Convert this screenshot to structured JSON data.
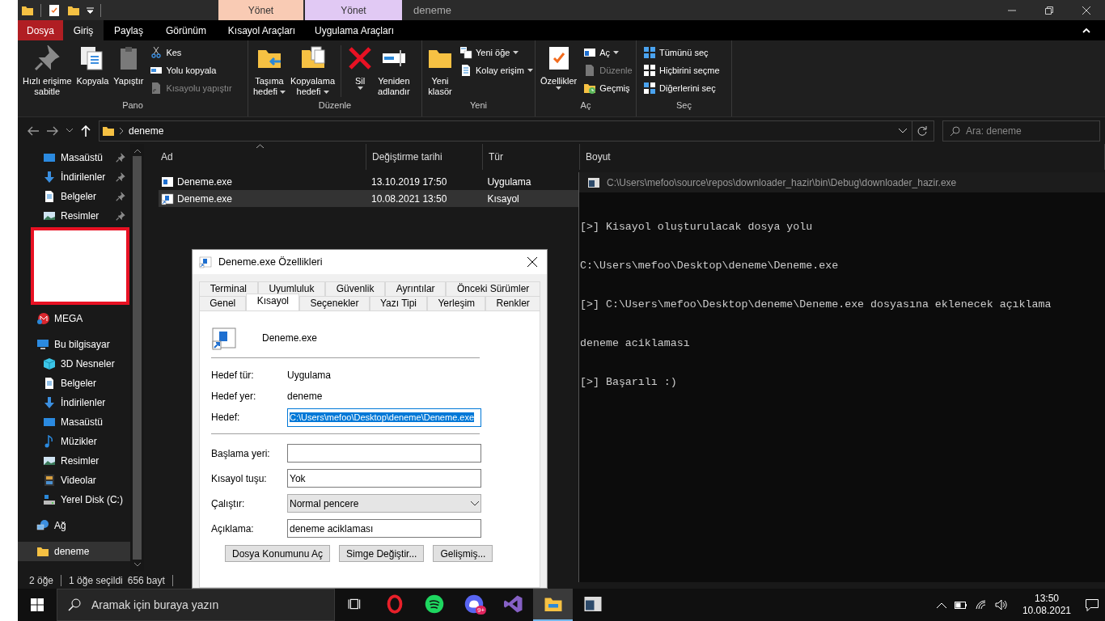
{
  "explorer": {
    "title": "deneme",
    "context_headers": [
      {
        "label": "Yönet",
        "color": "#f9cbb4"
      },
      {
        "label": "Yönet",
        "color": "#e1c9f4"
      }
    ],
    "ribbon_tabs": [
      {
        "label": "Dosya",
        "kind": "file",
        "selected": false
      },
      {
        "label": "Giriş",
        "kind": "tab",
        "selected": true
      },
      {
        "label": "Paylaş",
        "kind": "tab",
        "selected": false
      },
      {
        "label": "Görünüm",
        "kind": "tab",
        "selected": false
      },
      {
        "label": "Kısayol Araçları",
        "kind": "context",
        "selected": false
      },
      {
        "label": "Uygulama Araçları",
        "kind": "context",
        "selected": false
      }
    ],
    "ribbon_groups": [
      {
        "label": "Pano",
        "large": [
          {
            "lines": [
              "Hızlı erişime",
              "sabitle"
            ],
            "kind": "pin",
            "caret": false
          },
          {
            "lines": [
              "Kopyala"
            ],
            "kind": "copy",
            "caret": false
          },
          {
            "lines": [
              "Yapıştır"
            ],
            "kind": "paste",
            "caret": false
          }
        ],
        "small": [
          {
            "label": "Kes",
            "kind": "cut",
            "caret": false,
            "disabled": false
          },
          {
            "label": "Yolu kopyala",
            "kind": "path",
            "caret": false,
            "disabled": false
          },
          {
            "label": "Kısayolu yapıştır",
            "kind": "shortcut",
            "caret": false,
            "disabled": true
          }
        ]
      },
      {
        "label": "Düzenle",
        "large": [
          {
            "lines": [
              "Taşıma",
              "hedefi"
            ],
            "kind": "move",
            "caret": true
          },
          {
            "lines": [
              "Kopyalama",
              "hedefi"
            ],
            "kind": "copyto",
            "caret": true
          },
          {
            "lines": [
              "Sil"
            ],
            "kind": "delete",
            "caret": true,
            "divider_before": true
          },
          {
            "lines": [
              "Yeniden",
              "adlandır"
            ],
            "kind": "rename",
            "caret": false
          }
        ]
      },
      {
        "label": "Yeni",
        "large": [
          {
            "lines": [
              "Yeni",
              "klasör"
            ],
            "kind": "folder",
            "caret": false
          }
        ],
        "small": [
          {
            "label": "Yeni öğe",
            "kind": "newitem",
            "caret": true,
            "disabled": false
          },
          {
            "label": "Kolay erişim",
            "kind": "easy",
            "caret": true,
            "disabled": false
          }
        ]
      },
      {
        "label": "Aç",
        "large": [
          {
            "lines": [
              "Özellikler"
            ],
            "kind": "properties",
            "caret": true
          }
        ],
        "small": [
          {
            "label": "Aç",
            "kind": "open",
            "caret": true,
            "disabled": false
          },
          {
            "label": "Düzenle",
            "kind": "edit",
            "caret": false,
            "disabled": true
          },
          {
            "label": "Geçmiş",
            "kind": "history",
            "caret": false,
            "disabled": false
          }
        ]
      },
      {
        "label": "Seç",
        "small": [
          {
            "label": "Tümünü seç",
            "kind": "all",
            "caret": false,
            "disabled": false
          },
          {
            "label": "Hiçbirini seçme",
            "kind": "none",
            "caret": false,
            "disabled": false
          },
          {
            "label": "Diğerlerini seç",
            "kind": "invert",
            "caret": false,
            "disabled": false
          }
        ]
      }
    ],
    "address": {
      "crumb": "deneme",
      "search_placeholder": "Ara: deneme"
    },
    "sidebar": {
      "quick_access": [
        {
          "label": "Masaüstü",
          "kind": "desktop",
          "pinned": true,
          "selected": false
        },
        {
          "label": "İndirilenler",
          "kind": "download",
          "pinned": true,
          "selected": false
        },
        {
          "label": "Belgeler",
          "kind": "docs",
          "pinned": true,
          "selected": false
        },
        {
          "label": "Resimler",
          "kind": "pictures",
          "pinned": true,
          "selected": false
        }
      ],
      "redacted": true,
      "locations": [
        {
          "label": "MEGA",
          "kind": "mega",
          "selected": false
        },
        {
          "label": "Bu bilgisayar",
          "kind": "pc",
          "selected": false,
          "children": [
            {
              "label": "3D Nesneler",
              "kind": "cube",
              "selected": false
            },
            {
              "label": "Belgeler",
              "kind": "docs",
              "selected": false
            },
            {
              "label": "İndirilenler",
              "kind": "download",
              "selected": false
            },
            {
              "label": "Masaüstü",
              "kind": "desktop",
              "selected": false
            },
            {
              "label": "Müzikler",
              "kind": "music",
              "selected": false
            },
            {
              "label": "Resimler",
              "kind": "pictures",
              "selected": false
            },
            {
              "label": "Videolar",
              "kind": "video",
              "selected": false
            },
            {
              "label": "Yerel Disk (C:)",
              "kind": "disk",
              "selected": false
            }
          ]
        },
        {
          "label": "Ağ",
          "kind": "network",
          "selected": false
        },
        {
          "label": "deneme",
          "kind": "folder",
          "selected": true
        }
      ]
    },
    "table": {
      "columns": [
        {
          "label": "Ad",
          "sorted": true
        },
        {
          "label": "Değiştirme tarihi",
          "sorted": false
        },
        {
          "label": "Tür",
          "sorted": false
        },
        {
          "label": "Boyut",
          "sorted": false
        }
      ],
      "rows": [
        {
          "name": "Deneme.exe",
          "date": "13.10.2019 17:50",
          "type": "Uygulama",
          "kind": "app",
          "selected": false
        },
        {
          "name": "Deneme.exe",
          "date": "10.08.2021 13:50",
          "type": "Kısayol",
          "kind": "shortcut",
          "selected": true
        }
      ]
    },
    "status_bar": {
      "item_count": "2 öğe",
      "selection": "1 öğe seçildi",
      "size": "656 bayt"
    }
  },
  "console": {
    "title": "C:\\Users\\mefoo\\source\\repos\\downloader_hazir\\bin\\Debug\\downloader_hazir.exe",
    "lines": [
      "[>] Kisayol oluşturulacak dosya yolu",
      "C:\\Users\\mefoo\\Desktop\\deneme\\Deneme.exe",
      "[>] C:\\Users\\mefoo\\Desktop\\deneme\\Deneme.exe dosyasına eklenecek açıklama",
      "deneme aciklaması",
      "[>] Başarılı :)"
    ]
  },
  "dialog": {
    "title": "Deneme.exe Özellikleri",
    "tab_rows": [
      [
        {
          "label": "Terminal",
          "selected": false
        },
        {
          "label": "Uyumluluk",
          "selected": false
        },
        {
          "label": "Güvenlik",
          "selected": false
        },
        {
          "label": "Ayrıntılar",
          "selected": false
        },
        {
          "label": "Önceki Sürümler",
          "selected": false
        }
      ],
      [
        {
          "label": "Genel",
          "selected": false
        },
        {
          "label": "Kısayol",
          "selected": true
        },
        {
          "label": "Seçenekler",
          "selected": false
        },
        {
          "label": "Yazı Tipi",
          "selected": false
        },
        {
          "label": "Yerleşim",
          "selected": false
        },
        {
          "label": "Renkler",
          "selected": false
        }
      ]
    ],
    "file_name": "Deneme.exe",
    "info": [
      {
        "label": "Hedef tür:",
        "value": "Uygulama"
      },
      {
        "label": "Hedef yer:",
        "value": "deneme"
      }
    ],
    "target": {
      "label": "Hedef:",
      "value": "C:\\Users\\mefoo\\Desktop\\deneme\\Deneme.exe",
      "highlighted": true
    },
    "fields": [
      {
        "label": "Başlama yeri:",
        "kind": "text"
      },
      {
        "label": "Kısayol tuşu:",
        "kind": "text",
        "value": "Yok"
      },
      {
        "label": "Çalıştır:",
        "kind": "select",
        "value": "Normal pencere"
      },
      {
        "label": "Açıklama:",
        "kind": "text",
        "value": "deneme aciklaması"
      }
    ],
    "buttons": [
      "Dosya Konumunu Aç",
      "Simge Değiştir...",
      "Gelişmiş..."
    ]
  },
  "taskbar": {
    "search_placeholder": "Aramak için buraya yazın",
    "apps": [
      {
        "kind": "taskview",
        "active": false
      },
      {
        "kind": "opera",
        "active": false
      },
      {
        "kind": "spotify",
        "active": false
      },
      {
        "kind": "discord",
        "active": false,
        "badge": "9+"
      },
      {
        "kind": "vs",
        "active": false
      },
      {
        "kind": "explorer",
        "active": true
      },
      {
        "kind": "console",
        "active": false
      }
    ],
    "time": "13:50",
    "date": "10.08.2021"
  }
}
